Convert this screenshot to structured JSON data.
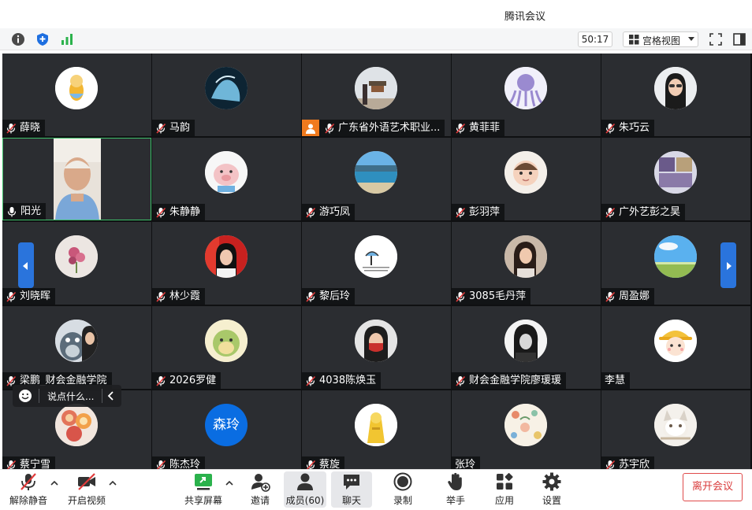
{
  "window": {
    "title": "腾讯会议"
  },
  "topbar": {
    "timer": "50:17",
    "view_mode": "宫格视图"
  },
  "participants": [
    {
      "name": "薛晓",
      "mic": "muted",
      "avatar": "cartoon-bee"
    },
    {
      "name": "马韵",
      "mic": "muted",
      "avatar": "horse-photo"
    },
    {
      "name": "广东省外语艺术职业...",
      "mic": "muted",
      "avatar": "temple-photo",
      "hand_raised": true
    },
    {
      "name": "黄菲菲",
      "mic": "muted",
      "avatar": "octopus-cartoon"
    },
    {
      "name": "朱巧云",
      "mic": "muted",
      "avatar": "woman-photo"
    },
    {
      "name": "阳光",
      "mic": "on",
      "avatar": "video-feed",
      "active": true
    },
    {
      "name": "朱静静",
      "mic": "muted",
      "avatar": "pig-cartoon"
    },
    {
      "name": "游巧凤",
      "mic": "muted",
      "avatar": "lake-photo"
    },
    {
      "name": "彭羽萍",
      "mic": "muted",
      "avatar": "baby-photo"
    },
    {
      "name": "广外艺彭之昊",
      "mic": "muted",
      "avatar": "collage-photo"
    },
    {
      "name": "刘晓晖",
      "mic": "muted",
      "avatar": "flower-photo"
    },
    {
      "name": "林少霞",
      "mic": "muted",
      "avatar": "woman-red-photo"
    },
    {
      "name": "黎后玲",
      "mic": "muted",
      "avatar": "sketch-card"
    },
    {
      "name": "3085毛丹萍",
      "mic": "muted",
      "avatar": "woman-photo-2"
    },
    {
      "name": "周盈娜",
      "mic": "muted",
      "avatar": "sky-photo"
    },
    {
      "name": "梁鹏_财会金融学院",
      "mic": "muted",
      "avatar": "totoro-selfie"
    },
    {
      "name": "2026罗健",
      "mic": "muted",
      "avatar": "dino-cartoon"
    },
    {
      "name": "4038陈焕玉",
      "mic": "muted",
      "avatar": "woman-mask-photo"
    },
    {
      "name": "财会金融学院廖瑗瑗",
      "mic": "muted",
      "avatar": "woman-bw-photo"
    },
    {
      "name": "李慧",
      "mic": "none",
      "avatar": "girl-hat-cartoon"
    },
    {
      "name": "蔡宁雪",
      "mic": "muted",
      "avatar": "fruit-photo"
    },
    {
      "name": "陈杰玲",
      "mic": "muted",
      "avatar": "text",
      "avatar_text": "森玲"
    },
    {
      "name": "蔡旋",
      "mic": "muted",
      "avatar": "yellow-figure"
    },
    {
      "name": "张玲",
      "mic": "none",
      "avatar": "floral-pattern"
    },
    {
      "name": "苏宇欣",
      "mic": "muted",
      "avatar": "cat-photo"
    }
  ],
  "chat_popup": {
    "placeholder": "说点什么..."
  },
  "toolbar": {
    "unmute": "解除静音",
    "start_video": "开启视频",
    "share_screen": "共享屏幕",
    "invite": "邀请",
    "members": "成员(60)",
    "chat": "聊天",
    "record": "录制",
    "raise_hand": "举手",
    "apps": "应用",
    "settings": "设置",
    "leave": "离开会议"
  },
  "colors": {
    "accent": "#0a6de2",
    "danger": "#e04b4b",
    "active_border": "#3ec16a",
    "tile_bg": "#2b2d31",
    "hand": "#f07a1e"
  }
}
